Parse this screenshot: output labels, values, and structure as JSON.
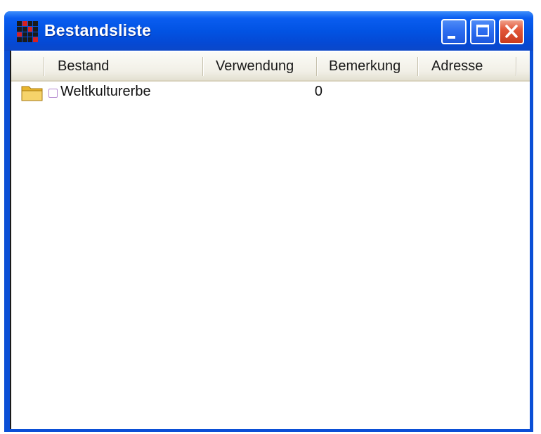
{
  "window": {
    "title": "Bestandsliste",
    "controls": {
      "minimize": "minimize-icon",
      "maximize": "maximize-icon",
      "close": "close-icon"
    }
  },
  "colors": {
    "titlebar": "#0253e3",
    "close_button": "#e3583a",
    "checkbox_border": "#b58ad0",
    "folder": "#f3c743"
  },
  "columns": [
    {
      "label": "Bestand"
    },
    {
      "label": "Verwendung"
    },
    {
      "label": "Bemerkung"
    },
    {
      "label": "Adresse"
    }
  ],
  "rows": [
    {
      "icon": "folder-icon",
      "checked": false,
      "name": "Weltkulturerbe",
      "verwendung": "0",
      "bemerkung": "",
      "adresse": ""
    }
  ]
}
